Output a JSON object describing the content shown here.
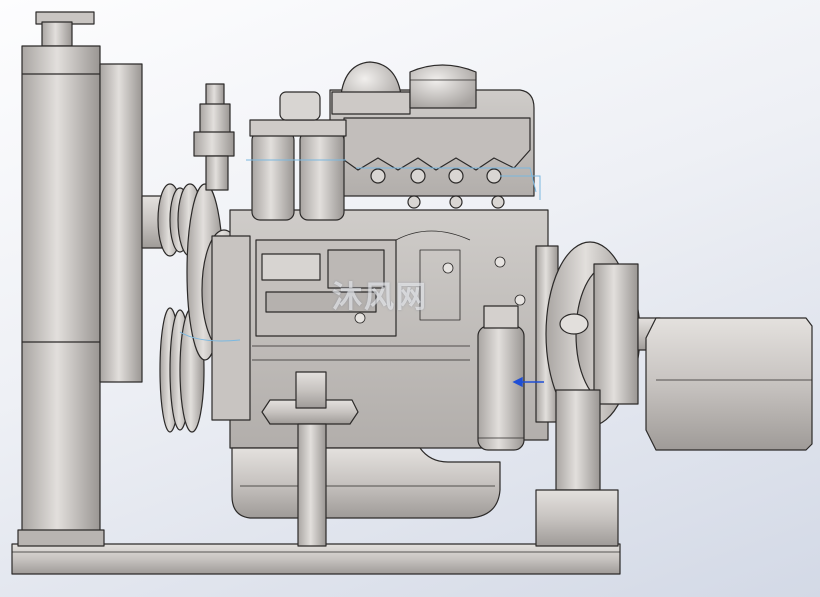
{
  "image": {
    "subject": "engine-cad-model",
    "watermark_text": "沐风网"
  },
  "colors": {
    "background_top": "#fdfdfe",
    "background_bottom": "#d3d9e6",
    "metal_light": "#d6d3d0",
    "metal_mid": "#bdb9b6",
    "metal_dark": "#8f8b88",
    "edge": "#2c2a29",
    "pipe_highlight": "#7ab8e0",
    "axis_marker": "#1f4fd6"
  }
}
